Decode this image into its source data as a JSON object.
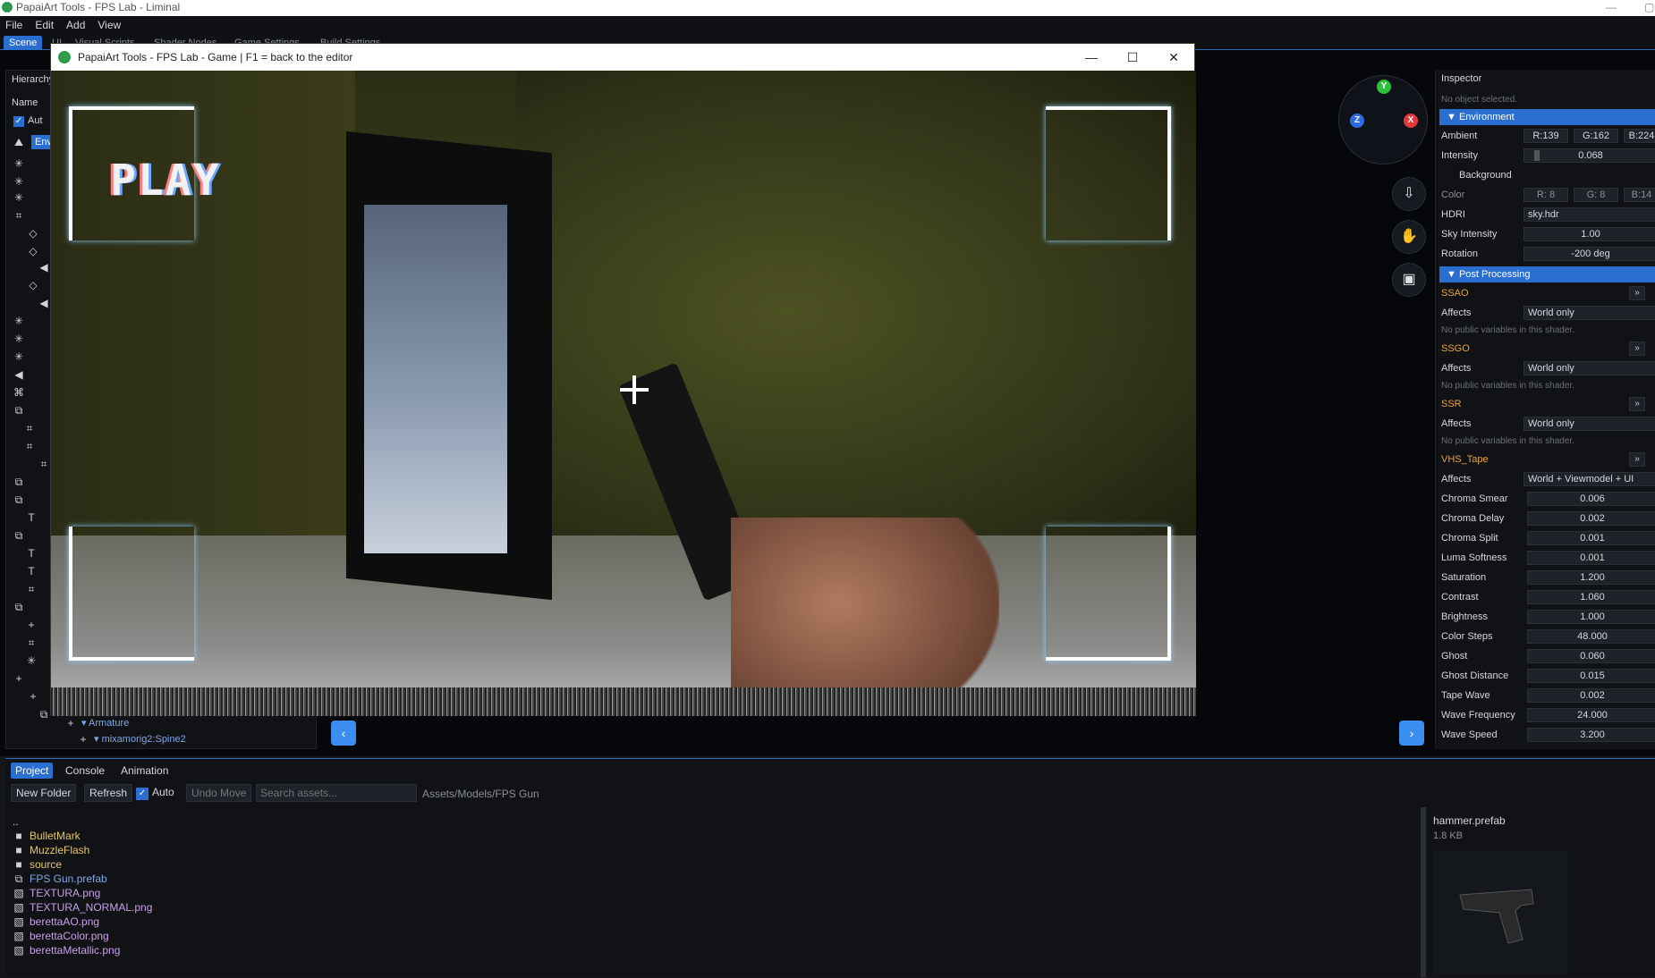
{
  "app": {
    "title": "PapaiArt Tools - FPS Lab - Liminal"
  },
  "menu": [
    "File",
    "Edit",
    "Add",
    "View"
  ],
  "editor_tabs": [
    "Scene",
    "UI",
    "Visual Scripts",
    "Shader Nodes",
    "Game Settings",
    "Build Settings"
  ],
  "hierarchy": {
    "title": "Hierarchy",
    "name_header": "Name",
    "auto_label": "Aut",
    "env_label": "Env",
    "tree_bottom": [
      "Armature",
      "mixamorig2:Spine2"
    ]
  },
  "game_window": {
    "title": "PapaiArt Tools - FPS Lab - Game  |  F1 = back to the editor",
    "overlay_text": "PLAY"
  },
  "gizmo": {
    "y": "Y",
    "x": "X",
    "z": "Z"
  },
  "inspector": {
    "title": "Inspector",
    "no_selection": "No object selected.",
    "environment": {
      "header": "Environment",
      "ambient_label": "Ambient",
      "ambient_r": "R:139",
      "ambient_g": "G:162",
      "ambient_b": "B:224",
      "intensity_label": "Intensity",
      "intensity_value": "0.068",
      "intensity_level": 0.07,
      "background_label": "Background",
      "color_label": "Color",
      "color_r": "R: 8",
      "color_g": "G: 8",
      "color_b": "B:14",
      "hdri_label": "HDRI",
      "hdri_value": "sky.hdr",
      "sky_label": "Sky Intensity",
      "sky_value": "1.00",
      "rotation_label": "Rotation",
      "rotation_value": "-200 deg"
    },
    "post": {
      "header": "Post Processing",
      "affects_label": "Affects",
      "no_vars": "No public variables in this shader.",
      "effects": [
        {
          "name": "SSAO",
          "affects": "World only"
        },
        {
          "name": "SSGO",
          "affects": "World only"
        },
        {
          "name": "SSR",
          "affects": "World only"
        }
      ],
      "vhs": {
        "name": "VHS_Tape",
        "affects": "World + Viewmodel + UI",
        "params": [
          {
            "label": "Chroma Smear",
            "value": "0.006"
          },
          {
            "label": "Chroma Delay",
            "value": "0.002"
          },
          {
            "label": "Chroma Split",
            "value": "0.001"
          },
          {
            "label": "Luma Softness",
            "value": "0.001"
          },
          {
            "label": "Saturation",
            "value": "1.200"
          },
          {
            "label": "Contrast",
            "value": "1.060"
          },
          {
            "label": "Brightness",
            "value": "1.000"
          },
          {
            "label": "Color Steps",
            "value": "48.000"
          },
          {
            "label": "Ghost",
            "value": "0.060"
          },
          {
            "label": "Ghost Distance",
            "value": "0.015"
          },
          {
            "label": "Tape Wave",
            "value": "0.002"
          },
          {
            "label": "Wave Frequency",
            "value": "24.000"
          },
          {
            "label": "Wave Speed",
            "value": "3.200"
          }
        ]
      }
    }
  },
  "bottom": {
    "tabs": [
      "Project",
      "Console",
      "Animation"
    ],
    "new_folder": "New Folder",
    "refresh": "Refresh",
    "auto": "Auto",
    "undo_move": "Undo Move",
    "search_placeholder": "Search assets...",
    "path": "Assets/Models/FPS Gun",
    "up": "..",
    "files": [
      {
        "name": "BulletMark",
        "type": "folder"
      },
      {
        "name": "MuzzleFlash",
        "type": "folder"
      },
      {
        "name": "source",
        "type": "folder"
      },
      {
        "name": "FPS Gun.prefab",
        "type": "prefab"
      },
      {
        "name": "TEXTURA.png",
        "type": "image"
      },
      {
        "name": "TEXTURA_NORMAL.png",
        "type": "image"
      },
      {
        "name": "berettaAO.png",
        "type": "image"
      },
      {
        "name": "berettaColor.png",
        "type": "image"
      },
      {
        "name": "berettaMetallic.png",
        "type": "image"
      }
    ],
    "preview": {
      "name": "hammer.prefab",
      "size": "1.8 KB"
    }
  },
  "colors": {
    "accent": "#2a6fd0",
    "folder": "#e7c66a",
    "link": "#7fa8e8",
    "warning": "#e7a540"
  }
}
